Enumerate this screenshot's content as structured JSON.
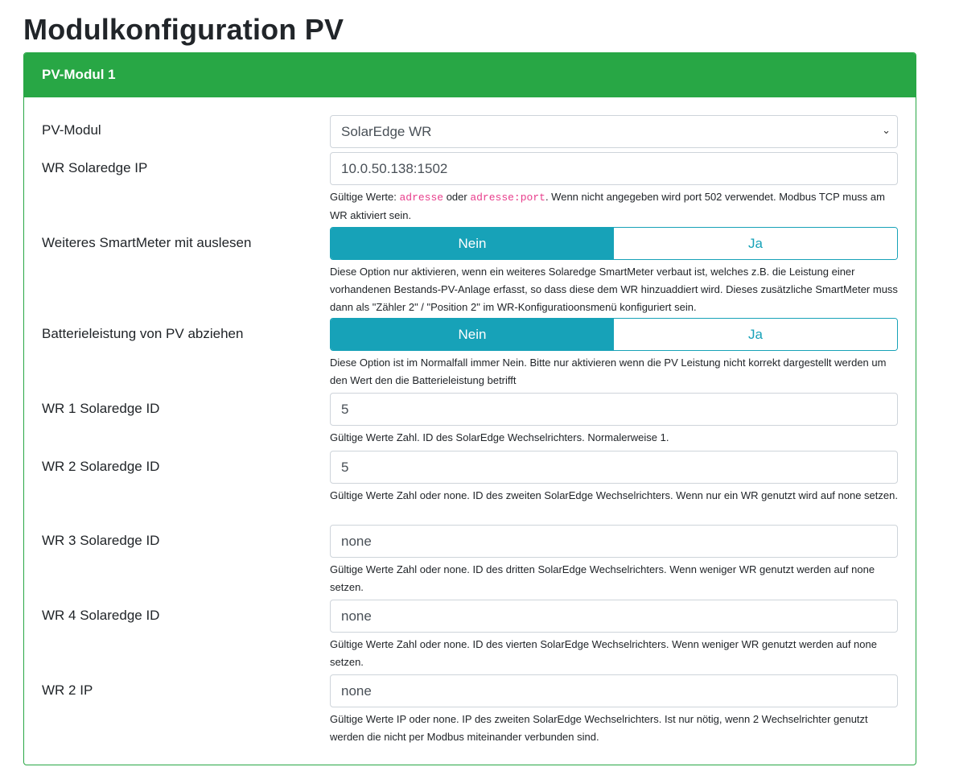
{
  "title": "Modulkonfiguration PV",
  "card": {
    "header": "PV-Modul 1"
  },
  "fields": {
    "pvmodul": {
      "label": "PV-Modul",
      "value": "SolarEdge WR"
    },
    "ip": {
      "label": "WR Solaredge IP",
      "value": "10.0.50.138:1502",
      "help_a": "Gültige Werte: ",
      "code1": "adresse",
      "help_b": " oder ",
      "code2": "adresse:port",
      "help_c": ". Wenn nicht angegeben wird port 502 verwendet. Modbus TCP muss am WR aktiviert sein."
    },
    "smartmeter": {
      "label": "Weiteres SmartMeter mit auslesen",
      "no": "Nein",
      "yes": "Ja",
      "selected": "Nein",
      "help": "Diese Option nur aktivieren, wenn ein weiteres Solaredge SmartMeter verbaut ist, welches z.B. die Leistung einer vorhandenen Bestands-PV-Anlage erfasst, so dass diese dem WR hinzuaddiert wird. Dieses zusätzliche SmartMeter muss dann als \"Zähler 2\" / \"Position 2\" im WR-Konfiguratioonsmenü konfiguriert sein."
    },
    "battery": {
      "label": "Batterieleistung von PV abziehen",
      "no": "Nein",
      "yes": "Ja",
      "selected": "Nein",
      "help": "Diese Option ist im Normalfall immer Nein. Bitte nur aktivieren wenn die PV Leistung nicht korrekt dargestellt werden um den Wert den die Batterieleistung betrifft"
    },
    "id1": {
      "label": "WR 1 Solaredge ID",
      "value": "5",
      "help": "Gültige Werte Zahl. ID des SolarEdge Wechselrichters. Normalerweise 1."
    },
    "id2": {
      "label": "WR 2 Solaredge ID",
      "value": "5",
      "help": "Gültige Werte Zahl oder none. ID des zweiten SolarEdge Wechselrichters. Wenn nur ein WR genutzt wird auf none setzen."
    },
    "id3": {
      "label": "WR 3 Solaredge ID",
      "value": "none",
      "help": "Gültige Werte Zahl oder none. ID des dritten SolarEdge Wechselrichters. Wenn weniger WR genutzt werden auf none setzen."
    },
    "id4": {
      "label": "WR 4 Solaredge ID",
      "value": "none",
      "help": "Gültige Werte Zahl oder none. ID des vierten SolarEdge Wechselrichters. Wenn weniger WR genutzt werden auf none setzen."
    },
    "ip2": {
      "label": "WR 2 IP",
      "value": "none",
      "help": "Gültige Werte IP oder none. IP des zweiten SolarEdge Wechselrichters. Ist nur nötig, wenn 2 Wechselrichter genutzt werden die nicht per Modbus miteinander verbunden sind."
    }
  }
}
